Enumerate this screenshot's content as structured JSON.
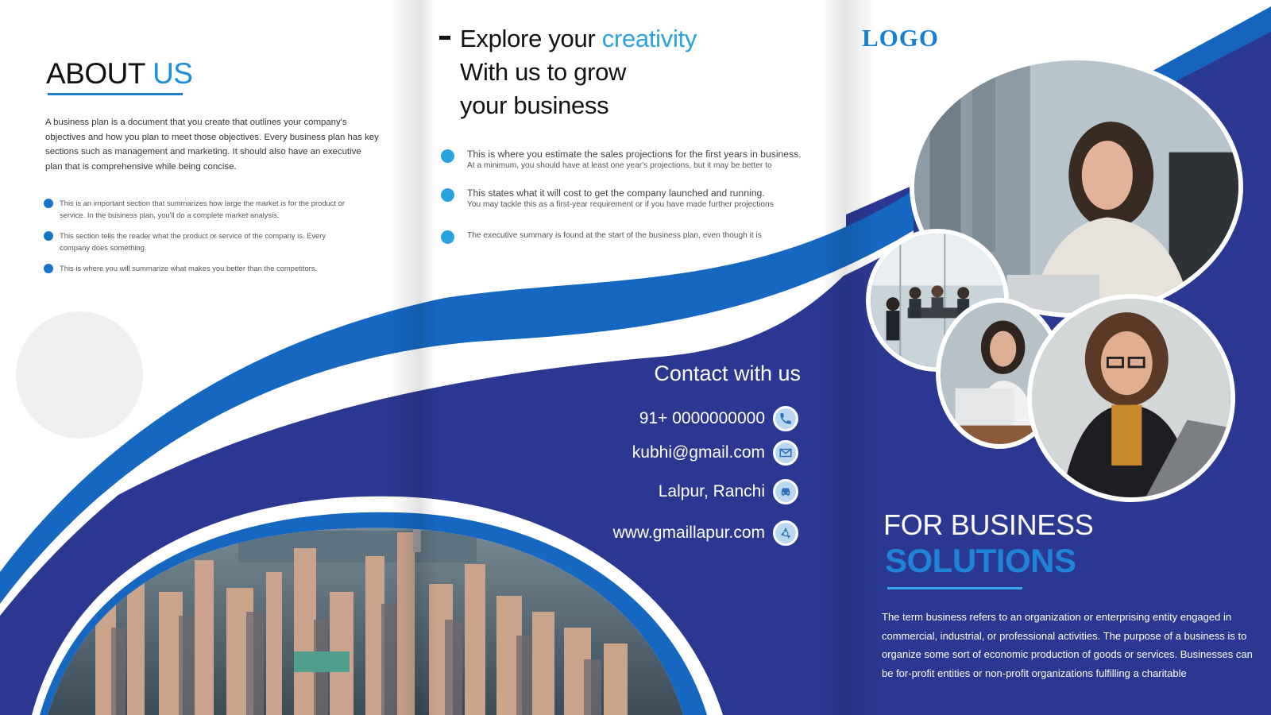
{
  "about": {
    "title_main": "ABOUT ",
    "title_accent": "US",
    "paragraph": "A business plan is a document that you create that outlines your company's objectives and how you plan to meet those objectives. Every business plan has key sections such as management and marketing. It should also have an executive plan that is comprehensive while being concise.",
    "bullets": [
      "This is an important section that summarizes how large the market is for the product or service. In the business plan, you'll do a complete market analysis.",
      "This section tells the reader what the product or service of the company is. Every company does something.",
      "This is where you will summarize what makes you better than the competitors."
    ]
  },
  "middle": {
    "headline": {
      "line1_main": "Explore your ",
      "line1_accent": "creativity",
      "line2": "With us to grow",
      "line3": "your business"
    },
    "bullets": [
      {
        "main": "This is where you estimate the sales projections for the first years in business.",
        "sub": "At a minimum, you should have at least one year's projections, but it may be better to"
      },
      {
        "main": "This states what it will cost to get the company launched and running.",
        "sub": "You may tackle this as a first-year requirement or if you have made further projections"
      },
      {
        "main": "",
        "sub": "The executive summary is found at the start of the business plan, even though it is"
      }
    ],
    "contact": {
      "title": "Contact with us",
      "phone": "91+ 0000000000",
      "email": "kubhi@gmail.com",
      "address": "Lalpur, Ranchi",
      "website": "www.gmaillapur.com",
      "icons": [
        "phone-icon",
        "mail-icon",
        "car-icon",
        "recycle-icon"
      ]
    }
  },
  "right": {
    "logo": "LOGO",
    "heading1": "FOR BUSINESS",
    "heading2": "SOLUTIONS",
    "paragraph": "The term business refers to an organization or enterprising entity engaged in commercial, industrial, or professional activities. The purpose of a business is to organize some sort of economic production of goods or services. Businesses can be for-profit entities or non-profit organizations fulfilling a charitable"
  },
  "colors": {
    "navy": "#2b3891",
    "blue": "#1565c0",
    "light_blue": "#29a3e0",
    "accent_blue": "#1e8fd6"
  }
}
